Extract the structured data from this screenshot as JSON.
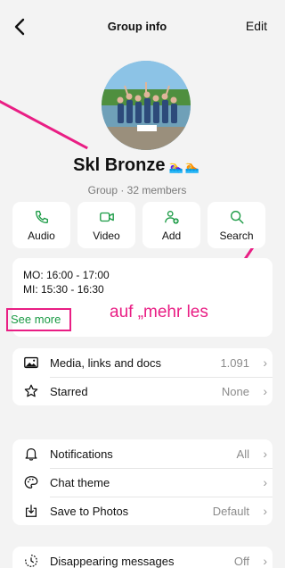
{
  "header": {
    "title": "Group info",
    "edit_label": "Edit"
  },
  "group": {
    "name": "Skl Bronze",
    "name_emoji": "🏊‍♀️🏊",
    "meta": "Group · 32 members"
  },
  "actions": [
    {
      "label": "Audio",
      "icon": "phone-icon"
    },
    {
      "label": "Video",
      "icon": "video-icon"
    },
    {
      "label": "Add",
      "icon": "add-person-icon"
    },
    {
      "label": "Search",
      "icon": "search-icon"
    }
  ],
  "description": {
    "line1": "MO: 16:00 - 17:00",
    "line2": "MI: 15:30 - 16:30",
    "see_more": "See more"
  },
  "annotation": {
    "text": "auf „mehr les",
    "color": "#e91e84"
  },
  "section1": [
    {
      "label": "Media, links and docs",
      "value": "1.091"
    },
    {
      "label": "Starred",
      "value": "None"
    }
  ],
  "section2": [
    {
      "label": "Notifications",
      "value": "All"
    },
    {
      "label": "Chat theme",
      "value": ""
    },
    {
      "label": "Save to Photos",
      "value": "Default"
    }
  ],
  "section3": [
    {
      "label": "Disappearing messages",
      "value": "Off"
    }
  ],
  "colors": {
    "accent_green": "#1b9b45",
    "highlight_pink": "#e91e84"
  }
}
